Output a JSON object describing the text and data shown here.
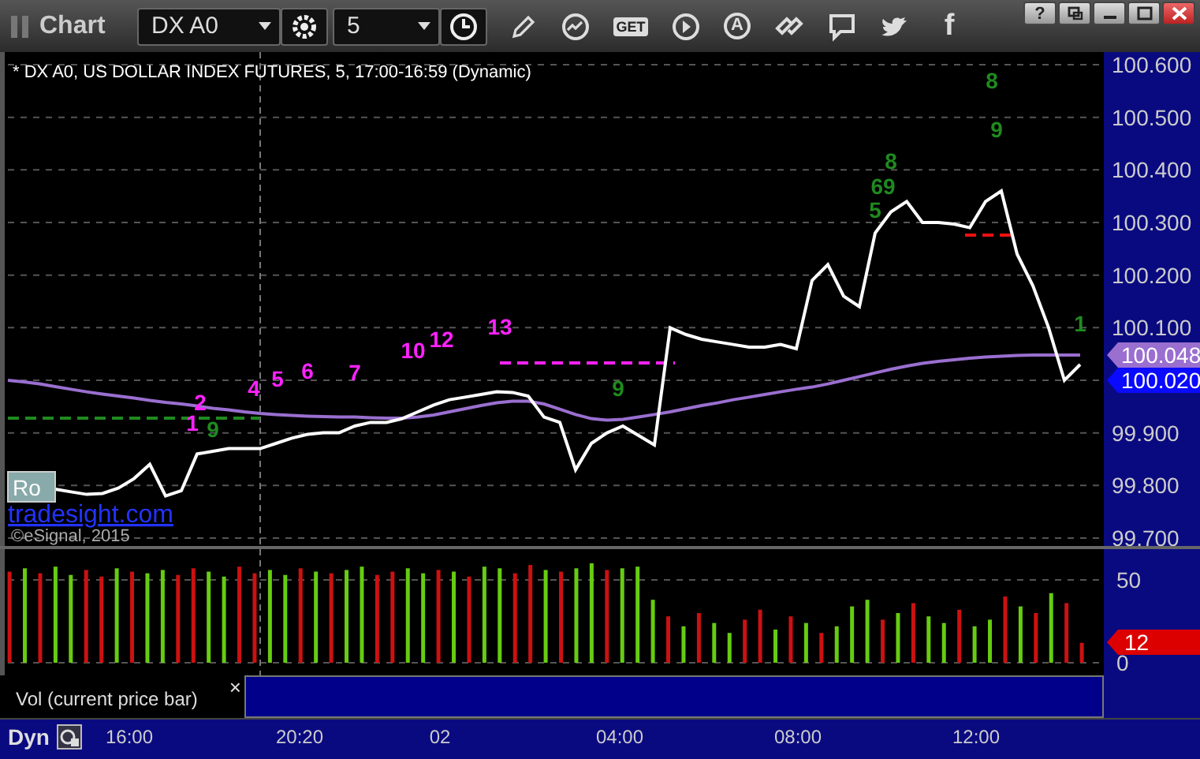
{
  "toolbar": {
    "title": "Chart",
    "symbol": "DX A0",
    "interval": "5",
    "tools": [
      {
        "kind": "pencil"
      },
      {
        "kind": "chart-refresh"
      },
      {
        "kind": "label",
        "label": "GET"
      },
      {
        "kind": "play"
      },
      {
        "kind": "circle-label",
        "label": "A"
      },
      {
        "kind": "link"
      },
      {
        "kind": "comment"
      },
      {
        "kind": "bird"
      },
      {
        "kind": "label",
        "label": "f"
      }
    ]
  },
  "window_buttons": [
    {
      "kind": "label",
      "label": "?"
    },
    {
      "kind": "restore"
    },
    {
      "kind": "minimize"
    },
    {
      "kind": "maximize"
    },
    {
      "kind": "close"
    }
  ],
  "price_panel": {
    "header": "* DX A0, US DOLLAR INDEX FUTURES, 5, 17:00-16:59 (Dynamic)",
    "badge": "Ro",
    "link": "tradesight.com",
    "copyright": "©eSignal, 2015",
    "counts": [
      {
        "text": "1",
        "color": "#ff22ff"
      },
      {
        "text": "2",
        "color": "#ff22ff"
      },
      {
        "text": "4",
        "color": "#ff22ff"
      },
      {
        "text": "5",
        "color": "#ff22ff"
      },
      {
        "text": "6",
        "color": "#ff22ff"
      },
      {
        "text": "7",
        "color": "#ff22ff"
      },
      {
        "text": "10",
        "color": "#ff22ff"
      },
      {
        "text": "12",
        "color": "#ff22ff"
      },
      {
        "text": "13",
        "color": "#ff22ff"
      },
      {
        "text": "9",
        "color": "#1f8a1f"
      },
      {
        "text": "9",
        "color": "#1f8a1f"
      },
      {
        "text": "5",
        "color": "#1f8a1f"
      },
      {
        "text": "8",
        "color": "#1f8a1f"
      },
      {
        "text": "69",
        "color": "#1f8a1f"
      },
      {
        "text": "8",
        "color": "#1f8a1f"
      },
      {
        "text": "9",
        "color": "#1f8a1f"
      },
      {
        "text": "1",
        "color": "#1f8a1f"
      }
    ],
    "price_markers": [
      {
        "label": "100.048",
        "color": "#9a6fd0"
      },
      {
        "label": "100.020",
        "color": "#0a0aff"
      }
    ],
    "chart_data": {
      "type": "line",
      "grid": true,
      "ylim": [
        99.7,
        100.6
      ],
      "series": [
        {
          "color": "#ffffff",
          "values": [
            null,
            null,
            null,
            99.793,
            99.788,
            99.783,
            99.785,
            99.795,
            99.813,
            99.84,
            99.78,
            99.79,
            99.86,
            99.865,
            99.87,
            99.87,
            99.87,
            99.88,
            99.89,
            99.897,
            99.9,
            99.9,
            99.913,
            99.92,
            99.92,
            99.927,
            99.94,
            99.953,
            99.963,
            99.968,
            99.973,
            99.978,
            99.977,
            99.97,
            99.93,
            99.92,
            99.83,
            99.88,
            99.9,
            99.913,
            99.895,
            99.877,
            100.1,
            100.087,
            100.078,
            100.073,
            100.068,
            100.063,
            100.063,
            100.068,
            100.06,
            100.19,
            100.22,
            100.16,
            100.14,
            100.28,
            100.32,
            100.34,
            100.3,
            100.3,
            100.297,
            100.29,
            100.34,
            100.36,
            100.24,
            100.18,
            100.1,
            100.0,
            100.03
          ]
        },
        {
          "color": "#9a6fd0",
          "values": [
            100.0,
            99.997,
            99.993,
            99.988,
            99.983,
            99.978,
            99.974,
            99.97,
            99.966,
            99.962,
            99.958,
            99.955,
            99.951,
            99.947,
            99.944,
            99.94,
            99.937,
            99.935,
            99.933,
            99.932,
            99.931,
            99.93,
            99.93,
            99.929,
            99.928,
            99.928,
            99.93,
            99.934,
            99.94,
            99.946,
            99.952,
            99.957,
            99.96,
            99.96,
            99.955,
            99.945,
            99.935,
            99.927,
            99.924,
            99.926,
            99.93,
            99.935,
            99.94,
            99.946,
            99.952,
            99.957,
            99.963,
            99.968,
            99.973,
            99.978,
            99.983,
            99.987,
            99.993,
            100.0,
            100.007,
            100.014,
            100.021,
            100.027,
            100.032,
            100.036,
            100.039,
            100.042,
            100.044,
            100.046,
            100.047,
            100.048,
            100.048,
            100.048,
            100.048
          ]
        }
      ],
      "yticks": [
        {
          "value": 100.6,
          "label": "100.600"
        },
        {
          "value": 100.5,
          "label": "100.500"
        },
        {
          "value": 100.4,
          "label": "100.400"
        },
        {
          "value": 100.3,
          "label": "100.300"
        },
        {
          "value": 100.2,
          "label": "100.200"
        },
        {
          "value": 100.1,
          "label": "100.100"
        },
        {
          "value": 99.9,
          "label": "99.900"
        },
        {
          "value": 99.8,
          "label": "99.800"
        },
        {
          "value": 99.7,
          "label": "99.700"
        }
      ]
    }
  },
  "volume_panel": {
    "current_value": "12",
    "chart_data": {
      "type": "bar",
      "stacked": true,
      "ylim": [
        0,
        60
      ],
      "yticks": [
        0,
        50
      ],
      "ref_lines": [
        {
          "axis": "y",
          "value": 50
        }
      ],
      "series": [
        {
          "color": "#66cc11",
          "values": [
            null,
            57,
            null,
            58,
            53,
            null,
            null,
            57,
            null,
            54,
            56,
            null,
            null,
            55,
            52,
            null,
            null,
            56,
            53,
            null,
            55,
            null,
            56,
            58,
            null,
            null,
            57,
            54,
            null,
            55,
            null,
            58,
            57,
            null,
            null,
            56,
            null,
            57,
            60,
            null,
            57,
            58,
            38,
            null,
            22,
            null,
            24,
            18,
            null,
            null,
            20,
            null,
            24,
            null,
            22,
            34,
            38,
            null,
            30,
            null,
            28,
            24,
            null,
            22,
            26,
            null,
            34,
            null,
            42,
            null,
            null
          ]
        },
        {
          "color": "#cc1111",
          "values": [
            55,
            null,
            54,
            null,
            null,
            56,
            52,
            null,
            55,
            null,
            null,
            53,
            57,
            null,
            null,
            58,
            54,
            null,
            null,
            57,
            null,
            54,
            null,
            null,
            53,
            55,
            null,
            null,
            56,
            null,
            52,
            null,
            null,
            54,
            59,
            null,
            55,
            null,
            null,
            56,
            null,
            null,
            null,
            28,
            null,
            30,
            null,
            null,
            26,
            32,
            null,
            28,
            null,
            18,
            null,
            null,
            null,
            26,
            null,
            36,
            null,
            null,
            32,
            null,
            null,
            40,
            null,
            30,
            null,
            36,
            12
          ]
        }
      ]
    }
  },
  "study_label": {
    "text": "Vol (current price bar)",
    "close": "×"
  },
  "time_axis": {
    "mode": "Dyn",
    "labels": [
      "16:00",
      "20:20",
      "02",
      "04:00",
      "08:00",
      "12:00"
    ]
  }
}
